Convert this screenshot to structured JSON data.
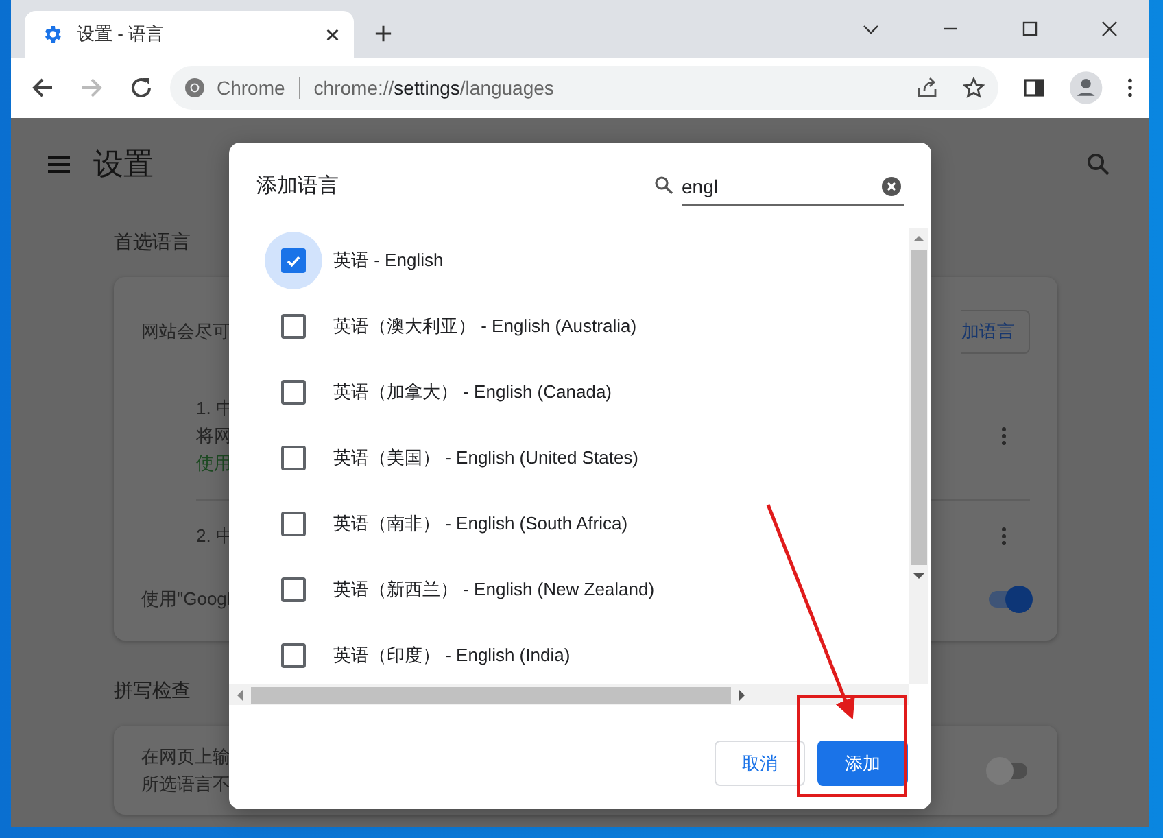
{
  "browser": {
    "tab": {
      "title": "设置 - 语言"
    },
    "omnibox": {
      "site_label": "Chrome",
      "url": {
        "scheme": "chrome://",
        "host": "settings",
        "path": "/languages"
      }
    }
  },
  "settings": {
    "title": "设置",
    "preferred_section": {
      "heading": "首选语言",
      "description": "网站会尽可",
      "add_button": "加语言",
      "languages": [
        {
          "lines": [
            "1. 中",
            "将网"
          ],
          "note": "使用"
        },
        {
          "lines": [
            "2. 中"
          ]
        }
      ],
      "translate_row": {
        "label": "使用\"Googl",
        "on": true
      }
    },
    "spell_section": {
      "heading": "拼写检查",
      "lines": [
        "在网页上输",
        "所选语言不"
      ],
      "on": false
    }
  },
  "dialog": {
    "title": "添加语言",
    "search": {
      "value": "engl"
    },
    "items": [
      {
        "label": "英语 - English",
        "checked": true,
        "focused": true
      },
      {
        "label": "英语（澳大利亚） - English (Australia)",
        "checked": false,
        "focused": false
      },
      {
        "label": "英语（加拿大） - English (Canada)",
        "checked": false,
        "focused": false
      },
      {
        "label": "英语（美国） - English (United States)",
        "checked": false,
        "focused": false
      },
      {
        "label": "英语（南非） - English (South Africa)",
        "checked": false,
        "focused": false
      },
      {
        "label": "英语（新西兰） - English (New Zealand)",
        "checked": false,
        "focused": false
      },
      {
        "label": "英语（印度） - English (India)",
        "checked": false,
        "focused": false
      }
    ],
    "buttons": [
      {
        "label": "取消",
        "kind": "secondary"
      },
      {
        "label": "添加",
        "kind": "primary"
      }
    ]
  }
}
